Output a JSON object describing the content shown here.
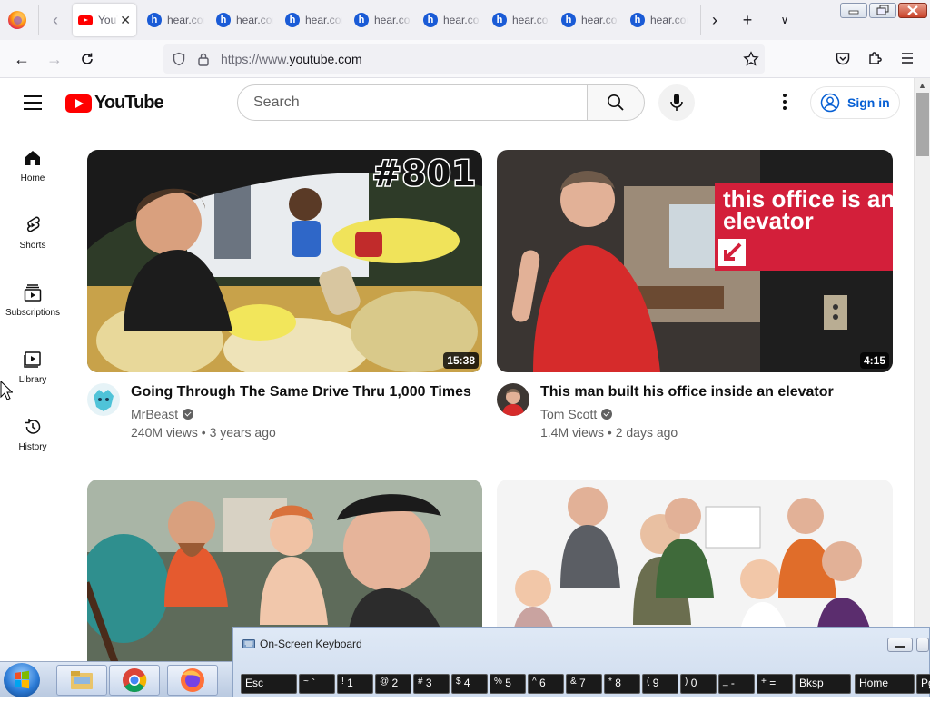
{
  "browser": {
    "tabs": [
      {
        "label": "YouTube",
        "favicon": "youtube-icon",
        "active": true
      },
      {
        "label": "hear.com",
        "favicon": "hear-icon"
      },
      {
        "label": "hear.com",
        "favicon": "hear-icon"
      },
      {
        "label": "hear.com",
        "favicon": "hear-icon"
      },
      {
        "label": "hear.com",
        "favicon": "hear-icon"
      },
      {
        "label": "hear.com",
        "favicon": "hear-icon"
      },
      {
        "label": "hear.com",
        "favicon": "hear-icon"
      },
      {
        "label": "hear.com",
        "favicon": "hear-icon"
      }
    ],
    "url_prefix": "https://www.",
    "url_domain": "youtube.com",
    "accent": "#0060df"
  },
  "youtube": {
    "logo_text": "YouTube",
    "search_placeholder": "Search",
    "sign_in_label": "Sign in",
    "brand_color": "#ff0000",
    "link_color": "#065fd4",
    "guide": [
      {
        "label": "Home",
        "icon": "home-icon"
      },
      {
        "label": "Shorts",
        "icon": "shorts-icon"
      },
      {
        "label": "Subscriptions",
        "icon": "subscriptions-icon"
      },
      {
        "label": "Library",
        "icon": "library-icon"
      },
      {
        "label": "History",
        "icon": "history-icon"
      }
    ],
    "videos": [
      {
        "title": "Going Through The Same Drive Thru 1,000 Times",
        "channel": "MrBeast",
        "verified": true,
        "views": "240M views",
        "age": "3 years ago",
        "duration": "15:38",
        "thumb_text": "#801"
      },
      {
        "title": "This man built his office inside an elevator",
        "channel": "Tom Scott",
        "verified": true,
        "views": "1.4M views",
        "age": "2 days ago",
        "duration": "4:15",
        "thumb_text": "this office is an elevator"
      }
    ]
  },
  "osk": {
    "title": "On-Screen Keyboard",
    "keys": [
      {
        "main": "Esc"
      },
      {
        "top": "~",
        "main": "`"
      },
      {
        "top": "!",
        "main": "1"
      },
      {
        "top": "@",
        "main": "2"
      },
      {
        "top": "#",
        "main": "3"
      },
      {
        "top": "$",
        "main": "4"
      },
      {
        "top": "%",
        "main": "5"
      },
      {
        "top": "^",
        "main": "6"
      },
      {
        "top": "&",
        "main": "7"
      },
      {
        "top": "*",
        "main": "8"
      },
      {
        "top": "(",
        "main": "9"
      },
      {
        "top": ")",
        "main": "0"
      },
      {
        "top": "_",
        "main": "-"
      },
      {
        "top": "+",
        "main": "="
      },
      {
        "main": "Bksp"
      },
      {
        "main": "Home"
      },
      {
        "main": "Pg"
      }
    ]
  },
  "taskbar": {
    "apps": [
      {
        "name": "windows-explorer-icon"
      },
      {
        "name": "chrome-icon"
      },
      {
        "name": "firefox-icon"
      }
    ]
  }
}
